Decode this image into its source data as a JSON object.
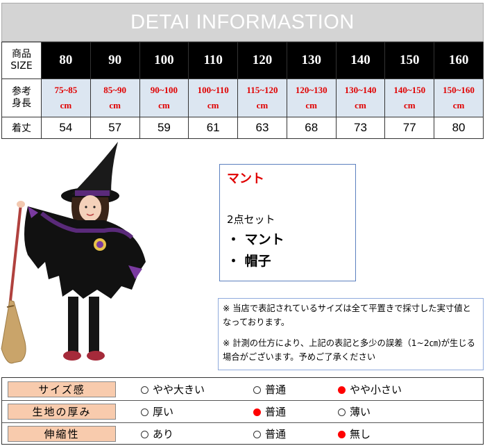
{
  "title": "DETAI INFORMASTION",
  "size_table": {
    "row_headers": {
      "size": "商品\nSIZE",
      "height": "参考\n身長",
      "length": "着丈"
    },
    "sizes": [
      "80",
      "90",
      "100",
      "110",
      "120",
      "130",
      "140",
      "150",
      "160"
    ],
    "heights": [
      "75~85\ncm",
      "85~90\ncm",
      "90~100\ncm",
      "100~110\ncm",
      "115~120\ncm",
      "120~130\ncm",
      "130~140\ncm",
      "140~150\ncm",
      "150~160\ncm"
    ],
    "lengths": [
      "54",
      "57",
      "59",
      "61",
      "63",
      "68",
      "73",
      "77",
      "80"
    ]
  },
  "product_box": {
    "title": "マント",
    "set_label": "2点セット",
    "items": [
      "・ マント",
      "・ 帽子"
    ]
  },
  "notes": [
    "※ 当店で表記されているサイズは全て平置きで採寸した実寸値となっております。",
    "※ 計測の仕方により、上記の表記と多少の誤差（1~2㎝)が生じる場合がございます。予めご了承ください"
  ],
  "ratings": [
    {
      "label": "サイズ感",
      "options": [
        "やや大きい",
        "普通",
        "やや小さい"
      ],
      "selected": 2
    },
    {
      "label": "生地の厚み",
      "options": [
        "厚い",
        "普通",
        "薄い"
      ],
      "selected": 1
    },
    {
      "label": "伸縮性",
      "options": [
        "あり",
        "普通",
        "無し"
      ],
      "selected": 2
    }
  ],
  "colors": {
    "accent_red": "#e00000",
    "rating_label_bg": "#f8cbad",
    "height_row_bg": "#dce6f1"
  }
}
